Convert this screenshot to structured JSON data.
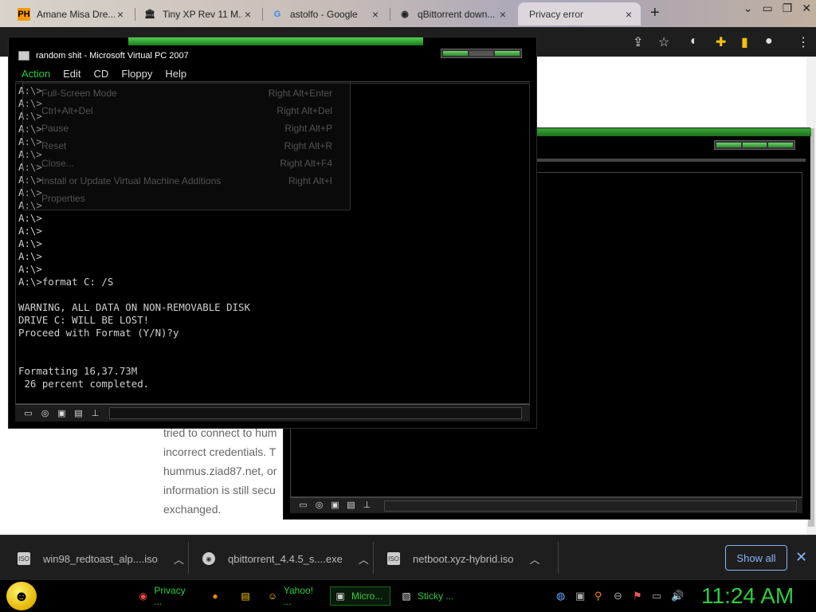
{
  "browser": {
    "tabs": [
      {
        "title": "Amane Misa Dre...",
        "favicon": "PH"
      },
      {
        "title": "Tiny XP Rev 11 M...",
        "favicon": "archive-icon"
      },
      {
        "title": "astolfo - Google",
        "favicon": "G"
      },
      {
        "title": "qBittorrent down...",
        "favicon": "github-icon"
      },
      {
        "title": "Privacy error",
        "favicon": ""
      }
    ],
    "new_tab": "+",
    "tab_close": "×"
  },
  "page": {
    "lines": [
      "tried to connect to hum",
      "incorrect credentials. T",
      "hummus.ziad87.net, or",
      "information is still secu",
      "exchanged."
    ]
  },
  "vpc": {
    "title": "random shit - Microsoft Virtual PC 2007",
    "menu": [
      "Action",
      "Edit",
      "CD",
      "Floppy",
      "Help"
    ],
    "action_menu": [
      {
        "label": "Full-Screen Mode",
        "shortcut": "Right Alt+Enter"
      },
      {
        "label": "Ctrl+Alt+Del",
        "shortcut": "Right Alt+Del"
      },
      {
        "label": "Pause",
        "shortcut": "Right Alt+P"
      },
      {
        "label": "Reset",
        "shortcut": "Right Alt+R"
      },
      {
        "label": "Close...",
        "shortcut": "Right Alt+F4"
      },
      {
        "label": "Install or Update Virtual Machine Additions",
        "shortcut": "Right Alt+I"
      },
      {
        "label": "Properties",
        "shortcut": ""
      }
    ],
    "console": "A:\\>\nA:\\>\nA:\\>\nA:\\>\nA:\\>\nA:\\>\nA:\\>\nA:\\>\nA:\\>\nA:\\>\nA:\\>\nA:\\>\nA:\\>\nA:\\>\nA:\\>\nA:\\>format C: /S\n\nWARNING, ALL DATA ON NON-REMOVABLE DISK\nDRIVE C: WILL BE LOST!\nProceed with Format (Y/N)?y\n\n\nFormatting 16,37.73M\n 26 percent completed."
  },
  "downloads": {
    "items": [
      {
        "name": "win98_redtoast_alp....iso",
        "icon": "disc-icon"
      },
      {
        "name": "qbittorrent_4.4.5_s....exe",
        "icon": "installer-icon"
      },
      {
        "name": "netboot.xyz-hybrid.iso",
        "icon": "disc-icon"
      }
    ],
    "show_all": "Show all",
    "close": "✕"
  },
  "taskbar": {
    "tasks": [
      {
        "label": "Privacy ...",
        "icon": "chrome-icon"
      },
      {
        "label": "",
        "icon": "firefox-icon"
      },
      {
        "label": "",
        "icon": "folder-icon"
      },
      {
        "label": "Yahoo! ...",
        "icon": "yahoo-messenger-icon"
      },
      {
        "label": "Micro...",
        "icon": "virtual-pc-icon"
      },
      {
        "label": "Sticky ...",
        "icon": "sticky-notes-icon"
      }
    ],
    "clock": "11:24 AM"
  }
}
